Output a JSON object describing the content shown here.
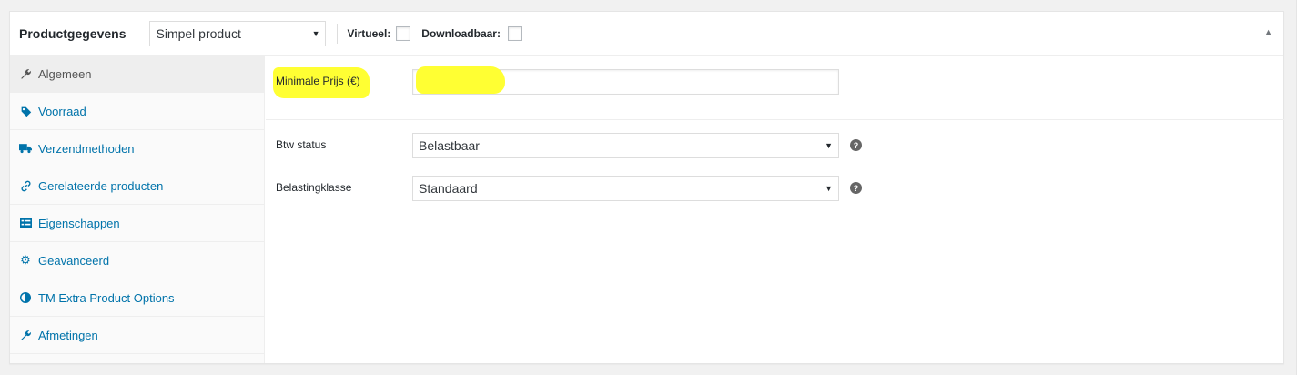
{
  "header": {
    "title": "Productgegevens",
    "dash": "—",
    "product_type": "Simpel product",
    "virtual_label": "Virtueel:",
    "downloadable_label": "Downloadbaar:",
    "toggle_icon": "triangle-up-icon"
  },
  "tabs": [
    {
      "label": "Algemeen",
      "icon": "wrench-icon",
      "active": true
    },
    {
      "label": "Voorraad",
      "icon": "tag-icon",
      "active": false
    },
    {
      "label": "Verzendmethoden",
      "icon": "truck-icon",
      "active": false
    },
    {
      "label": "Gerelateerde producten",
      "icon": "link-icon",
      "active": false
    },
    {
      "label": "Eigenschappen",
      "icon": "list-icon",
      "active": false
    },
    {
      "label": "Geavanceerd",
      "icon": "gear-icon",
      "active": false
    },
    {
      "label": "TM Extra Product Options",
      "icon": "contrast-icon",
      "active": false
    },
    {
      "label": "Afmetingen",
      "icon": "wrench-icon",
      "active": false
    }
  ],
  "fields": {
    "min_price_label": "Minimale Prijs (€)",
    "min_price_value": "",
    "tax_status_label": "Btw status",
    "tax_status_value": "Belastbaar",
    "tax_class_label": "Belastingklasse",
    "tax_class_value": "Standaard"
  },
  "colors": {
    "link": "#0073aa",
    "highlight": "#ffff33"
  }
}
